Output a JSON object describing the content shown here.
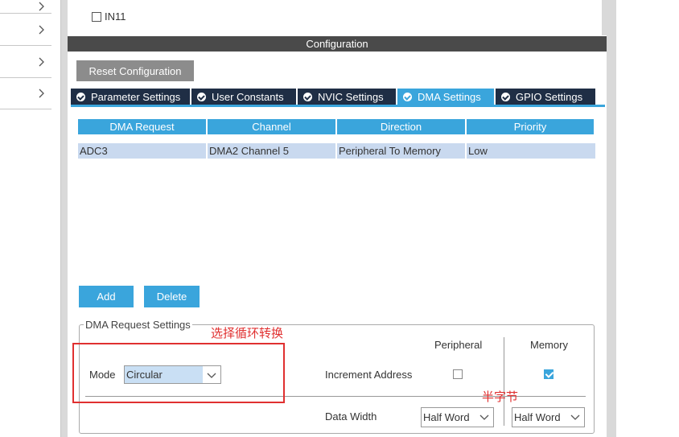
{
  "top_pane": {
    "checkbox_label": "IN11"
  },
  "config_header": "Configuration",
  "reset_button": "Reset Configuration",
  "tabs": [
    {
      "label": "Parameter Settings",
      "active": false
    },
    {
      "label": "User Constants",
      "active": false
    },
    {
      "label": "NVIC Settings",
      "active": false
    },
    {
      "label": "DMA Settings",
      "active": true
    },
    {
      "label": "GPIO Settings",
      "active": false
    }
  ],
  "table": {
    "headers": [
      "DMA Request",
      "Channel",
      "Direction",
      "Priority"
    ],
    "rows": [
      [
        "ADC3",
        "DMA2 Channel 5",
        "Peripheral To Memory",
        "Low"
      ]
    ]
  },
  "buttons": {
    "add": "Add",
    "delete": "Delete"
  },
  "request_settings": {
    "legend": "DMA Request Settings",
    "mode_label": "Mode",
    "mode_value": "Circular",
    "peripheral_header": "Peripheral",
    "memory_header": "Memory",
    "increment_address_label": "Increment Address",
    "increment_peripheral": false,
    "increment_memory": true,
    "data_width_label": "Data Width",
    "data_width_peripheral": "Half Word",
    "data_width_memory": "Half Word"
  },
  "annotations": {
    "mode_note": "选择循环转换",
    "width_note": "半字节"
  },
  "colors": {
    "accent": "#3aa5dc",
    "tab_dark": "#1f2e45",
    "header_dark": "#4a4a4a",
    "annotation_red": "#e03030"
  }
}
